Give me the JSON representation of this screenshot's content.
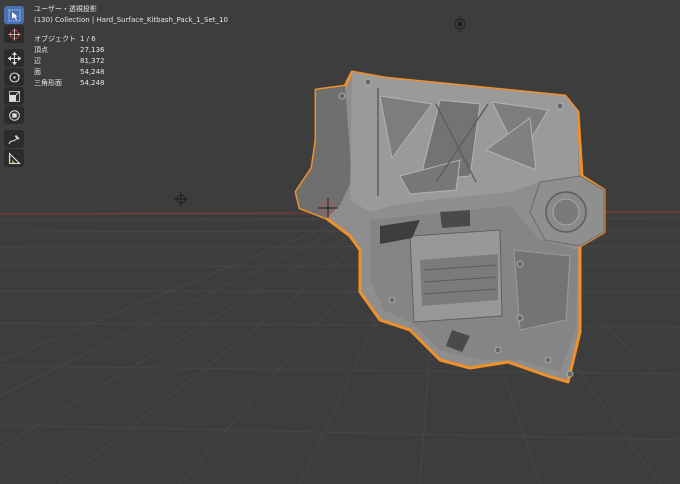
{
  "viewport": {
    "view_label": "ユーザー・透視投影",
    "collection_label": "(130) Collection | Hard_Surface_Kitbash_Pack_1_Set_10"
  },
  "stats": [
    {
      "label": "オブジェクト",
      "value": "1 / 6"
    },
    {
      "label": "頂点",
      "value": "27,136"
    },
    {
      "label": "辺",
      "value": "81,372"
    },
    {
      "label": "面",
      "value": "54,248"
    },
    {
      "label": "三角形面",
      "value": "54,248"
    }
  ],
  "tools": [
    {
      "name": "select-box-tool",
      "icon": "cursor-arrow-icon",
      "active": true
    },
    {
      "name": "cursor-tool",
      "icon": "3d-cursor-icon",
      "active": false
    },
    {
      "name": "move-tool",
      "icon": "move-arrows-icon",
      "active": false
    },
    {
      "name": "rotate-tool",
      "icon": "rotate-icon",
      "active": false
    },
    {
      "name": "scale-tool",
      "icon": "scale-icon",
      "active": false
    },
    {
      "name": "transform-tool",
      "icon": "transform-icon",
      "active": false
    },
    {
      "name": "annotate-tool",
      "icon": "annotate-pen-icon",
      "active": false
    },
    {
      "name": "measure-tool",
      "icon": "ruler-icon",
      "active": false
    }
  ],
  "colors": {
    "background": "#3d3d3d",
    "grid_line": "#474747",
    "x_axis": "#8a3c3c",
    "selection_outline": "#f0902a",
    "active_tool": "#4772b3",
    "mesh_base": "#8e8e8e"
  }
}
